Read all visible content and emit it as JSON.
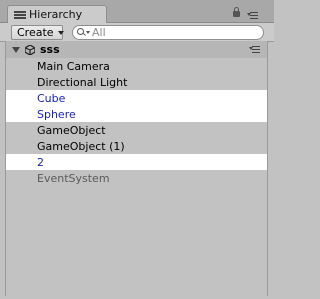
{
  "panel": {
    "tab_label": "Hierarchy",
    "tab_icon": "list-icon",
    "lock_icon": "lock-icon",
    "menu_icon": "context-menu-icon"
  },
  "toolbar": {
    "create_label": "Create",
    "search_placeholder": "All",
    "search_value": ""
  },
  "scene": {
    "name": "sss",
    "expanded": true,
    "icon": "unity-logo-icon"
  },
  "items": [
    {
      "label": "Main Camera",
      "state": "normal"
    },
    {
      "label": "Directional Light",
      "state": "normal"
    },
    {
      "label": "Cube",
      "state": "selected"
    },
    {
      "label": "Sphere",
      "state": "selected"
    },
    {
      "label": "GameObject",
      "state": "normal"
    },
    {
      "label": "GameObject (1)",
      "state": "normal"
    },
    {
      "label": "2",
      "state": "selected"
    },
    {
      "label": "EventSystem",
      "state": "inactive"
    }
  ],
  "colors": {
    "panel_bg": "#c2c2c2",
    "selected_bg": "#ffffff",
    "selected_text": "#1a23b9",
    "inactive_text": "#5a5a5a"
  }
}
